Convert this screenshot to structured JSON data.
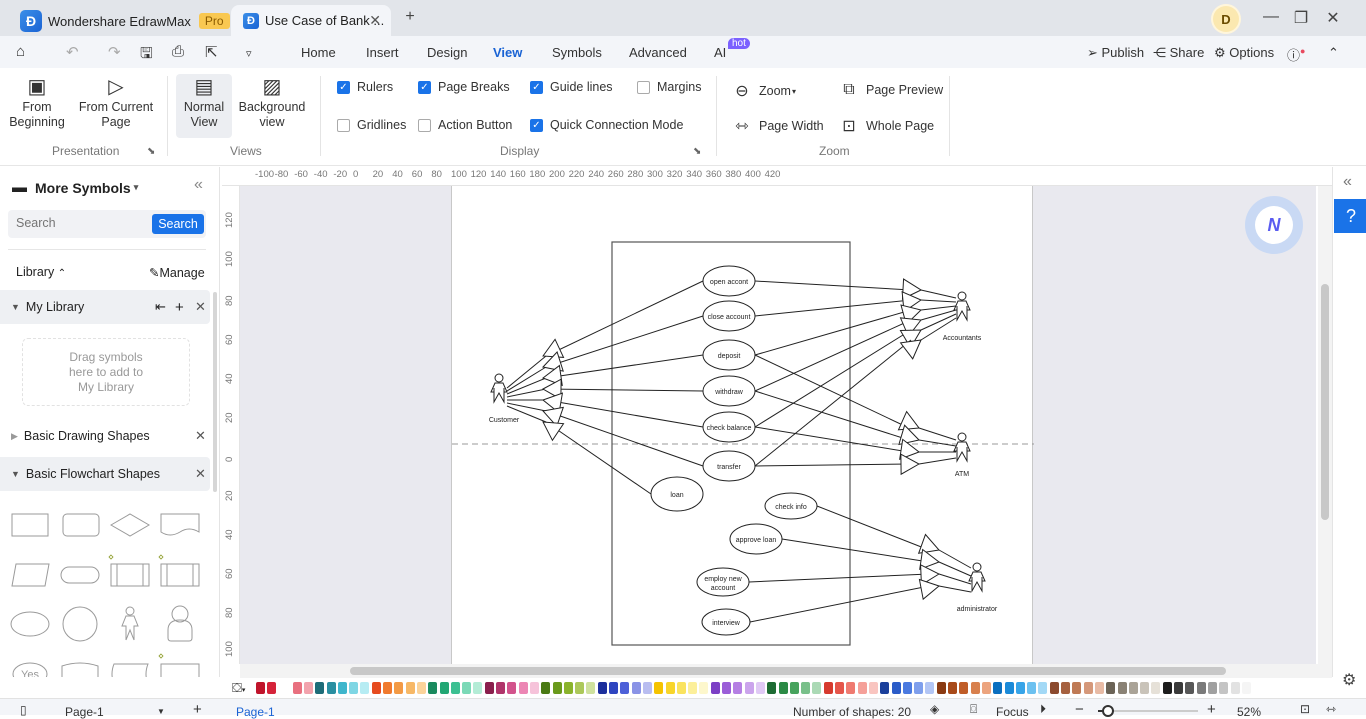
{
  "titlebar": {
    "app_name": "Wondershare EdrawMax",
    "app_badge": "Pro",
    "doc_tab": "Use Case of Bank ...",
    "avatar_letter": "D"
  },
  "menubar": {
    "menus": [
      "Home",
      "Insert",
      "Design",
      "View",
      "Symbols",
      "Advanced",
      "AI"
    ],
    "active_menu": "View",
    "ai_badge": "hot",
    "right": {
      "publish": "Publish",
      "share": "Share",
      "options": "Options"
    }
  },
  "ribbon": {
    "presentation": {
      "from_beginning": [
        "From",
        "Beginning"
      ],
      "from_current": [
        "From Current",
        "Page"
      ],
      "label": "Presentation"
    },
    "views": {
      "normal": [
        "Normal",
        "View"
      ],
      "background": [
        "Background",
        "view"
      ],
      "label": "Views"
    },
    "display": {
      "label": "Display",
      "options": [
        {
          "label": "Rulers",
          "checked": true
        },
        {
          "label": "Page Breaks",
          "checked": true
        },
        {
          "label": "Guide lines",
          "checked": true
        },
        {
          "label": "Margins",
          "checked": false
        },
        {
          "label": "Gridlines",
          "checked": false
        },
        {
          "label": "Action Button",
          "checked": false
        },
        {
          "label": "Quick Connection Mode",
          "checked": true
        }
      ]
    },
    "zoom": {
      "label": "Zoom",
      "zoom": "Zoom",
      "page_preview": "Page Preview",
      "page_width": "Page Width",
      "whole_page": "Whole Page"
    }
  },
  "leftpanel": {
    "title": "More Symbols",
    "search_placeholder": "Search",
    "search_button": "Search",
    "library_label": "Library",
    "manage_label": "Manage",
    "my_library": "My Library",
    "drop_hint": [
      "Drag symbols",
      "here to add to",
      "My Library"
    ],
    "sections": [
      "Basic Drawing Shapes",
      "Basic Flowchart Shapes"
    ],
    "yes_shape": "Yes"
  },
  "rulers": {
    "horizontal": [
      "-100",
      "-80",
      "-60",
      "-40",
      "-20",
      "0",
      "20",
      "40",
      "60",
      "80",
      "100",
      "120",
      "140",
      "160",
      "180",
      "200",
      "220",
      "240",
      "260",
      "280",
      "300",
      "320",
      "340",
      "360",
      "380",
      "400",
      "420"
    ],
    "vertical": [
      "120",
      "100",
      "80",
      "60",
      "40",
      "20",
      "0",
      "20",
      "40",
      "60",
      "80",
      "100"
    ]
  },
  "diagram": {
    "actors": [
      "Customer",
      "Accountants",
      "ATM",
      "administrator"
    ],
    "use_cases": [
      "open accont",
      "close account",
      "deposit",
      "withdraw",
      "check balance",
      "transfer",
      "loan",
      "check info",
      "approve loan",
      "employ new account",
      "interview"
    ]
  },
  "colorbar": {
    "colors": [
      "#c0142b",
      "#d5233a",
      "#e8707f",
      "#f2a3ad",
      "#1e6c78",
      "#2a8fa1",
      "#3fb6cc",
      "#7fd6e4",
      "#b6ecf3",
      "#e64b1f",
      "#f07a2e",
      "#f39a45",
      "#f7b866",
      "#fbd39a",
      "#1a8a5e",
      "#22a774",
      "#3cc092",
      "#7bd9b7",
      "#b4ecd6",
      "#8a1f4c",
      "#b0346a",
      "#d2538c",
      "#ec86b4",
      "#f6c3da",
      "#4a7a14",
      "#6a9a1c",
      "#8ab32c",
      "#acc85a",
      "#cfe19e",
      "#1c2f9c",
      "#2e45c0",
      "#4d60d8",
      "#8a93e6",
      "#b9bdf0",
      "#f5c300",
      "#f8d52a",
      "#fae35e",
      "#fcef9a",
      "#fdf7cc",
      "#7c3fc5",
      "#9b5ed8",
      "#b57fe3",
      "#cba4ec",
      "#e0c9f5",
      "#1d6b33",
      "#2b8a45",
      "#47a35d",
      "#79c08a",
      "#abd9b5",
      "#d63a2e",
      "#e5554a",
      "#ef7a70",
      "#f5a099",
      "#f9c5c0",
      "#1b3f9b",
      "#2b5cc8",
      "#4b7ae0",
      "#7f9fec",
      "#b3c6f5",
      "#8a3a12",
      "#a84a1a",
      "#c05d28",
      "#d8804d",
      "#eca47e",
      "#0b6fbf",
      "#1a8ad8",
      "#37a4e8",
      "#6cc1f0",
      "#a3d9f6",
      "#8c4a2e",
      "#a6613f",
      "#bf7a55",
      "#d5987a",
      "#e8bba5",
      "#6b6356",
      "#8a8275",
      "#aaa397",
      "#c9c3b9",
      "#e6e1d8",
      "#1d1d1d",
      "#3a3a3a",
      "#575757",
      "#7a7a7a",
      "#a0a0a0",
      "#c4c4c4",
      "#e2e2e2",
      "#f5f5f5"
    ]
  },
  "statusbar": {
    "page_selector": "Page-1",
    "page_tab": "Page-1",
    "shape_count": "Number of shapes: 20",
    "focus": "Focus",
    "zoom_level": "52%",
    "zoom_fraction": 0.1
  }
}
